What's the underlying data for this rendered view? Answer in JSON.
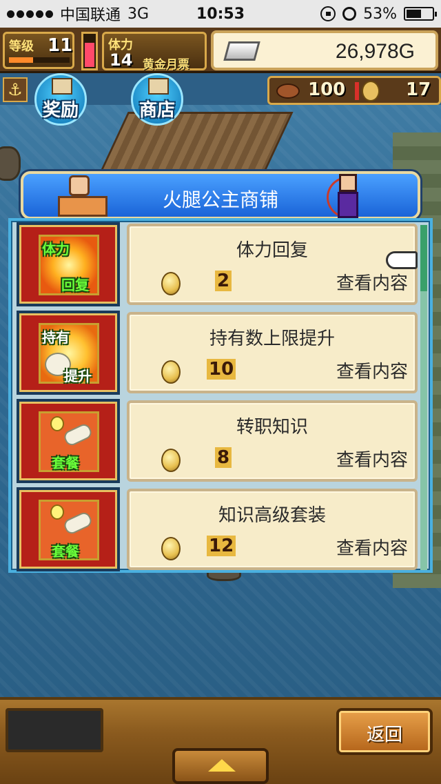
{
  "status_bar": {
    "carrier": "中国联通",
    "network": "3G",
    "time": "10:53",
    "battery": "53%"
  },
  "hud": {
    "level_label": "等级",
    "level_value": "11",
    "stamina_label": "体力",
    "stamina_value": "14",
    "ticket_label": "黄金月票",
    "gold": "26,978G",
    "food": "100",
    "coins": "17"
  },
  "nav_buttons": {
    "reward": "奖励",
    "shop": "商店"
  },
  "shop": {
    "title": "火腿公主商铺",
    "items": [
      {
        "name": "体力回复",
        "price": "2",
        "action": "查看内容",
        "icon_t1": "体力",
        "icon_t2": "回复"
      },
      {
        "name": "持有数上限提升",
        "price": "10",
        "action": "查看内容",
        "icon_t1": "持有",
        "icon_t2": "提升"
      },
      {
        "name": "转职知识",
        "price": "8",
        "action": "查看内容",
        "icon_t1": "",
        "icon_t2": "套餐"
      },
      {
        "name": "知识高级套装",
        "price": "12",
        "action": "查看内容",
        "icon_t1": "",
        "icon_t2": "套餐"
      }
    ]
  },
  "bottom": {
    "back_label": "返回"
  },
  "colors": {
    "header_blue": "#1a64d8",
    "card_bg": "#f7ecc9",
    "icon_red": "#b52018",
    "wood": "#8a5a1e"
  }
}
